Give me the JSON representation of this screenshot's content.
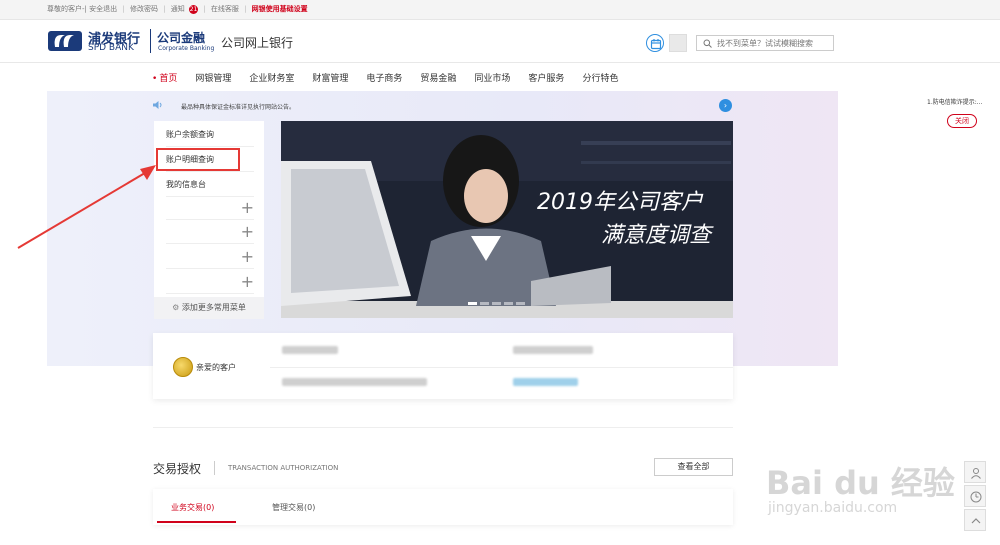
{
  "topbar": {
    "greeting": "尊敬的客户-|",
    "logout": "安全退出",
    "change_password": "修改密码",
    "notice": "通知",
    "notice_count": "21",
    "online_service": "在线客服",
    "basic_settings": "网银使用基础设置"
  },
  "header": {
    "bank_cn": "浦发银行",
    "bank_en": "SPD BANK",
    "corp_cn": "公司金融",
    "corp_en": "Corporate Banking",
    "site_title": "公司网上银行",
    "search_placeholder": "找不到菜单？试试模糊搜索"
  },
  "nav": {
    "items": [
      "首页",
      "网银管理",
      "企业财务室",
      "财富管理",
      "电子商务",
      "贸易金融",
      "同业市场",
      "客户服务",
      "分行特色"
    ]
  },
  "notice_bar": {
    "text": "最品种具体保证金标准详见执行网站公告。"
  },
  "quick_menu": {
    "items": [
      "账户余额查询",
      "账户明细查询",
      "我的信息台"
    ],
    "plus": "+",
    "footer": "添加更多常用菜单"
  },
  "banner": {
    "line1": "2019年公司客户",
    "line2": "满意度调查"
  },
  "customer": {
    "label": "亲爱的客户"
  },
  "transactions": {
    "title": "交易授权",
    "title_en": "TRANSACTION AUTHORIZATION",
    "view_all": "查看全部",
    "tab_business": "业务交易(0)",
    "tab_management": "管理交易(0)"
  },
  "right_notice": {
    "text": "1.防电信欺诈提示:...",
    "close": "关闭"
  },
  "watermark": {
    "main": "Bai du 经验",
    "sub": "jingyan.baidu.com"
  },
  "colors": {
    "brand_red": "#d0021b",
    "brand_blue": "#1b3a7a",
    "accent_blue": "#2f8fe0"
  }
}
